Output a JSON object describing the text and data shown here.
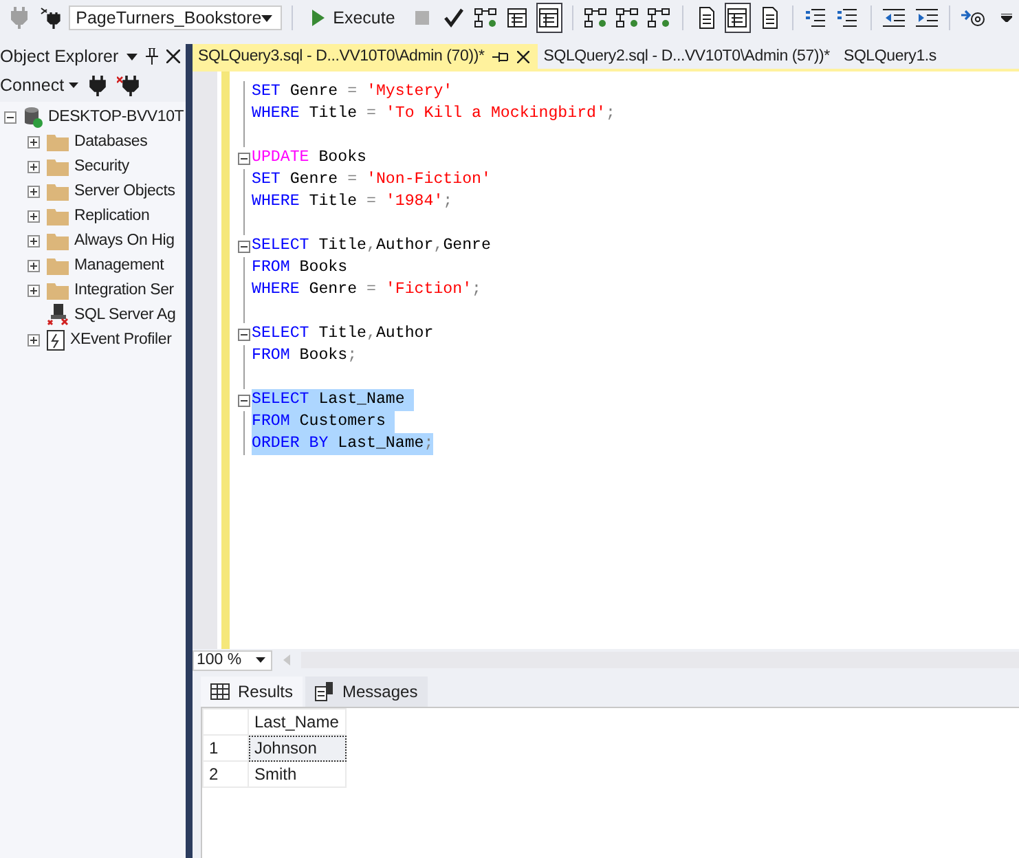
{
  "toolbar": {
    "items": [
      {
        "kind": "connect",
        "pressed": false
      },
      {
        "kind": "change-connection",
        "pressed": false
      },
      {
        "kind": "database",
        "value": "PageTurners_Bookstore"
      },
      {
        "kind": "separator"
      },
      {
        "kind": "execute",
        "label": "Execute"
      },
      {
        "kind": "stop",
        "pressed": false
      },
      {
        "kind": "parse",
        "pressed": false
      },
      {
        "kind": "display-plan",
        "pressed": false
      },
      {
        "kind": "query-options",
        "pressed": false
      },
      {
        "kind": "intellisense",
        "pressed": true
      },
      {
        "kind": "separator"
      },
      {
        "kind": "include-plan",
        "pressed": false
      },
      {
        "kind": "live-stats",
        "pressed": false
      },
      {
        "kind": "client-stats",
        "pressed": false
      },
      {
        "kind": "separator"
      },
      {
        "kind": "results-text",
        "pressed": false
      },
      {
        "kind": "results-grid",
        "pressed": true
      },
      {
        "kind": "results-file",
        "pressed": false
      },
      {
        "kind": "separator"
      },
      {
        "kind": "comment",
        "pressed": false
      },
      {
        "kind": "uncomment",
        "pressed": false
      },
      {
        "kind": "separator"
      },
      {
        "kind": "outdent",
        "pressed": false
      },
      {
        "kind": "indent",
        "pressed": false
      },
      {
        "kind": "separator"
      },
      {
        "kind": "specify-values",
        "pressed": false
      },
      {
        "kind": "overflow",
        "pressed": false
      }
    ]
  },
  "object_explorer": {
    "title": "Object Explorer",
    "connect": "Connect",
    "tree": [
      {
        "label": "DESKTOP-BVV10T",
        "kind": "server",
        "expanded": true,
        "children": [
          {
            "label": "Databases",
            "kind": "folder",
            "expanded": false
          },
          {
            "label": "Security",
            "kind": "folder",
            "expanded": false
          },
          {
            "label": "Server Objects",
            "kind": "folder",
            "expanded": false
          },
          {
            "label": "Replication",
            "kind": "folder",
            "expanded": false
          },
          {
            "label": "Always On Hig",
            "kind": "folder",
            "expanded": false
          },
          {
            "label": "Management",
            "kind": "folder",
            "expanded": false
          },
          {
            "label": "Integration Ser",
            "kind": "folder",
            "expanded": false
          },
          {
            "label": "SQL Server Ag",
            "kind": "agent"
          },
          {
            "label": "XEvent Profiler",
            "kind": "profiler",
            "expanded": false
          }
        ]
      }
    ]
  },
  "tabs": [
    {
      "label": "SQLQuery3.sql - D...VV10T0\\Admin (70))*",
      "selected": true
    },
    {
      "label": "SQLQuery2.sql - D...VV10T0\\Admin (57))*",
      "selected": false
    },
    {
      "label": "SQLQuery1.s",
      "selected": false
    }
  ],
  "editor": {
    "lines": [
      {
        "fold": false,
        "selected": false,
        "tokens": [
          {
            "kind": "keyword",
            "text": "SET"
          },
          {
            "kind": "plain",
            "text": " Genre "
          },
          {
            "kind": "operator",
            "text": "= "
          },
          {
            "kind": "string",
            "text": "'Mystery'"
          }
        ]
      },
      {
        "fold": false,
        "selected": false,
        "tokens": [
          {
            "kind": "keyword",
            "text": "WHERE"
          },
          {
            "kind": "plain",
            "text": " Title "
          },
          {
            "kind": "operator",
            "text": "= "
          },
          {
            "kind": "string",
            "text": "'To Kill a Mockingbird'"
          },
          {
            "kind": "operator",
            "text": ";"
          }
        ]
      },
      {
        "fold": false,
        "selected": false
      },
      {
        "fold": true,
        "selected": false,
        "tokens": [
          {
            "kind": "function",
            "text": "UPDATE"
          },
          {
            "kind": "plain",
            "text": " Books"
          }
        ]
      },
      {
        "fold": false,
        "selected": false,
        "tokens": [
          {
            "kind": "keyword",
            "text": "SET"
          },
          {
            "kind": "plain",
            "text": " Genre "
          },
          {
            "kind": "operator",
            "text": "= "
          },
          {
            "kind": "string",
            "text": "'Non-Fiction'"
          }
        ]
      },
      {
        "fold": false,
        "selected": false,
        "tokens": [
          {
            "kind": "keyword",
            "text": "WHERE"
          },
          {
            "kind": "plain",
            "text": " Title "
          },
          {
            "kind": "operator",
            "text": "= "
          },
          {
            "kind": "string",
            "text": "'1984'"
          },
          {
            "kind": "operator",
            "text": ";"
          }
        ]
      },
      {
        "fold": false,
        "selected": false
      },
      {
        "fold": true,
        "selected": false,
        "tokens": [
          {
            "kind": "keyword",
            "text": "SELECT"
          },
          {
            "kind": "plain",
            "text": " Title"
          },
          {
            "kind": "operator",
            "text": ","
          },
          {
            "kind": "plain",
            "text": "Author"
          },
          {
            "kind": "operator",
            "text": ","
          },
          {
            "kind": "plain",
            "text": "Genre"
          }
        ]
      },
      {
        "fold": false,
        "selected": false,
        "tokens": [
          {
            "kind": "keyword",
            "text": "FROM"
          },
          {
            "kind": "plain",
            "text": " Books"
          }
        ]
      },
      {
        "fold": false,
        "selected": false,
        "tokens": [
          {
            "kind": "keyword",
            "text": "WHERE"
          },
          {
            "kind": "plain",
            "text": " Genre "
          },
          {
            "kind": "operator",
            "text": "= "
          },
          {
            "kind": "string",
            "text": "'Fiction'"
          },
          {
            "kind": "operator",
            "text": ";"
          }
        ]
      },
      {
        "fold": false,
        "selected": false
      },
      {
        "fold": true,
        "selected": false,
        "tokens": [
          {
            "kind": "keyword",
            "text": "SELECT"
          },
          {
            "kind": "plain",
            "text": " Title"
          },
          {
            "kind": "operator",
            "text": ","
          },
          {
            "kind": "plain",
            "text": "Author"
          }
        ]
      },
      {
        "fold": false,
        "selected": false,
        "tokens": [
          {
            "kind": "keyword",
            "text": "FROM"
          },
          {
            "kind": "plain",
            "text": " Books"
          },
          {
            "kind": "operator",
            "text": ";"
          }
        ]
      },
      {
        "fold": false,
        "selected": false
      },
      {
        "fold": true,
        "selected": true,
        "tokens": [
          {
            "kind": "keyword",
            "text": "SELECT"
          },
          {
            "kind": "plain",
            "text": " Last_Name "
          }
        ]
      },
      {
        "fold": false,
        "selected": true,
        "tokens": [
          {
            "kind": "keyword",
            "text": "FROM"
          },
          {
            "kind": "plain",
            "text": " Customers "
          }
        ]
      },
      {
        "fold": false,
        "selected": true,
        "tokens": [
          {
            "kind": "keyword",
            "text": "ORDER BY"
          },
          {
            "kind": "plain",
            "text": " Last_Name"
          },
          {
            "kind": "operator",
            "text": ";"
          }
        ]
      }
    ],
    "zoom": "100 %"
  },
  "results": {
    "tabs": [
      {
        "label": "Results",
        "kind": "grid",
        "selected": true
      },
      {
        "label": "Messages",
        "kind": "messages",
        "selected": false
      }
    ],
    "columns": [
      "Last_Name"
    ],
    "rows": [
      {
        "number": "1",
        "cells": [
          "Johnson"
        ],
        "selected": true
      },
      {
        "number": "2",
        "cells": [
          "Smith"
        ],
        "selected": false
      }
    ]
  }
}
